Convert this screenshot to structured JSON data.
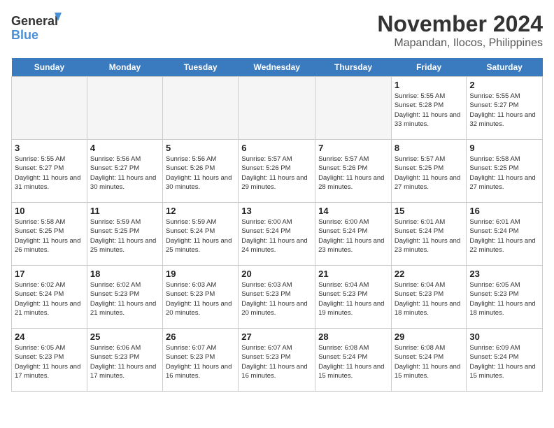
{
  "logo": {
    "line1": "General",
    "line2": "Blue"
  },
  "title": "November 2024",
  "subtitle": "Mapandan, Ilocos, Philippines",
  "days": [
    "Sunday",
    "Monday",
    "Tuesday",
    "Wednesday",
    "Thursday",
    "Friday",
    "Saturday"
  ],
  "weeks": [
    [
      {
        "date": "",
        "info": ""
      },
      {
        "date": "",
        "info": ""
      },
      {
        "date": "",
        "info": ""
      },
      {
        "date": "",
        "info": ""
      },
      {
        "date": "",
        "info": ""
      },
      {
        "date": "1",
        "info": "Sunrise: 5:55 AM\nSunset: 5:28 PM\nDaylight: 11 hours and 33 minutes."
      },
      {
        "date": "2",
        "info": "Sunrise: 5:55 AM\nSunset: 5:27 PM\nDaylight: 11 hours and 32 minutes."
      }
    ],
    [
      {
        "date": "3",
        "info": "Sunrise: 5:55 AM\nSunset: 5:27 PM\nDaylight: 11 hours and 31 minutes."
      },
      {
        "date": "4",
        "info": "Sunrise: 5:56 AM\nSunset: 5:27 PM\nDaylight: 11 hours and 30 minutes."
      },
      {
        "date": "5",
        "info": "Sunrise: 5:56 AM\nSunset: 5:26 PM\nDaylight: 11 hours and 30 minutes."
      },
      {
        "date": "6",
        "info": "Sunrise: 5:57 AM\nSunset: 5:26 PM\nDaylight: 11 hours and 29 minutes."
      },
      {
        "date": "7",
        "info": "Sunrise: 5:57 AM\nSunset: 5:26 PM\nDaylight: 11 hours and 28 minutes."
      },
      {
        "date": "8",
        "info": "Sunrise: 5:57 AM\nSunset: 5:25 PM\nDaylight: 11 hours and 27 minutes."
      },
      {
        "date": "9",
        "info": "Sunrise: 5:58 AM\nSunset: 5:25 PM\nDaylight: 11 hours and 27 minutes."
      }
    ],
    [
      {
        "date": "10",
        "info": "Sunrise: 5:58 AM\nSunset: 5:25 PM\nDaylight: 11 hours and 26 minutes."
      },
      {
        "date": "11",
        "info": "Sunrise: 5:59 AM\nSunset: 5:25 PM\nDaylight: 11 hours and 25 minutes."
      },
      {
        "date": "12",
        "info": "Sunrise: 5:59 AM\nSunset: 5:24 PM\nDaylight: 11 hours and 25 minutes."
      },
      {
        "date": "13",
        "info": "Sunrise: 6:00 AM\nSunset: 5:24 PM\nDaylight: 11 hours and 24 minutes."
      },
      {
        "date": "14",
        "info": "Sunrise: 6:00 AM\nSunset: 5:24 PM\nDaylight: 11 hours and 23 minutes."
      },
      {
        "date": "15",
        "info": "Sunrise: 6:01 AM\nSunset: 5:24 PM\nDaylight: 11 hours and 23 minutes."
      },
      {
        "date": "16",
        "info": "Sunrise: 6:01 AM\nSunset: 5:24 PM\nDaylight: 11 hours and 22 minutes."
      }
    ],
    [
      {
        "date": "17",
        "info": "Sunrise: 6:02 AM\nSunset: 5:24 PM\nDaylight: 11 hours and 21 minutes."
      },
      {
        "date": "18",
        "info": "Sunrise: 6:02 AM\nSunset: 5:23 PM\nDaylight: 11 hours and 21 minutes."
      },
      {
        "date": "19",
        "info": "Sunrise: 6:03 AM\nSunset: 5:23 PM\nDaylight: 11 hours and 20 minutes."
      },
      {
        "date": "20",
        "info": "Sunrise: 6:03 AM\nSunset: 5:23 PM\nDaylight: 11 hours and 20 minutes."
      },
      {
        "date": "21",
        "info": "Sunrise: 6:04 AM\nSunset: 5:23 PM\nDaylight: 11 hours and 19 minutes."
      },
      {
        "date": "22",
        "info": "Sunrise: 6:04 AM\nSunset: 5:23 PM\nDaylight: 11 hours and 18 minutes."
      },
      {
        "date": "23",
        "info": "Sunrise: 6:05 AM\nSunset: 5:23 PM\nDaylight: 11 hours and 18 minutes."
      }
    ],
    [
      {
        "date": "24",
        "info": "Sunrise: 6:05 AM\nSunset: 5:23 PM\nDaylight: 11 hours and 17 minutes."
      },
      {
        "date": "25",
        "info": "Sunrise: 6:06 AM\nSunset: 5:23 PM\nDaylight: 11 hours and 17 minutes."
      },
      {
        "date": "26",
        "info": "Sunrise: 6:07 AM\nSunset: 5:23 PM\nDaylight: 11 hours and 16 minutes."
      },
      {
        "date": "27",
        "info": "Sunrise: 6:07 AM\nSunset: 5:23 PM\nDaylight: 11 hours and 16 minutes."
      },
      {
        "date": "28",
        "info": "Sunrise: 6:08 AM\nSunset: 5:24 PM\nDaylight: 11 hours and 15 minutes."
      },
      {
        "date": "29",
        "info": "Sunrise: 6:08 AM\nSunset: 5:24 PM\nDaylight: 11 hours and 15 minutes."
      },
      {
        "date": "30",
        "info": "Sunrise: 6:09 AM\nSunset: 5:24 PM\nDaylight: 11 hours and 15 minutes."
      }
    ]
  ]
}
